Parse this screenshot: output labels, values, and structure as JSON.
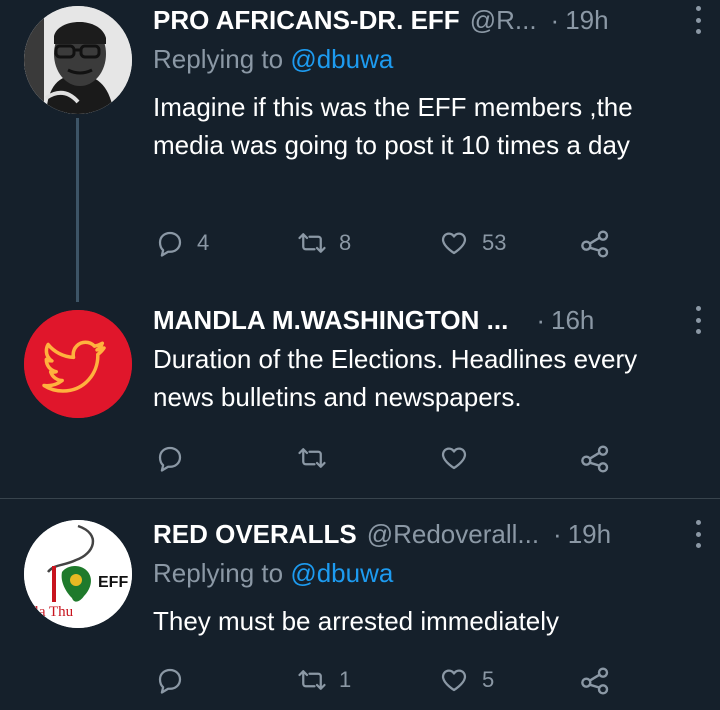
{
  "tweets": [
    {
      "name": "PRO AFRICANS-DR. EFF",
      "handle": "@R...",
      "time": "19h",
      "replying_label": "Replying to ",
      "replying_to": "@dbuwa",
      "text": "Imagine if this was the EFF members ,the media was going to post it 10 times a day",
      "replies": "4",
      "retweets": "8",
      "likes": "53"
    },
    {
      "name": "MANDLA M.WASHINGTON ...",
      "handle": "",
      "time": "16h",
      "text": "Duration of the Elections. Headlines every news bulletins and newspapers.",
      "replies": "",
      "retweets": "",
      "likes": ""
    },
    {
      "name": "RED OVERALLS",
      "handle": "@Redoverall...",
      "time": "19h",
      "replying_label": "Replying to ",
      "replying_to": "@dbuwa",
      "text": "They must be arrested immediately",
      "replies": "",
      "retweets": "1",
      "likes": "5",
      "avatar_text": "EFF",
      "avatar_text2": "ela Thu"
    }
  ],
  "colors": {
    "background": "#15202b",
    "text": "#ffffff",
    "secondary": "#8b98a5",
    "link": "#1d9bf0",
    "twitter_red": "#e0162b"
  }
}
